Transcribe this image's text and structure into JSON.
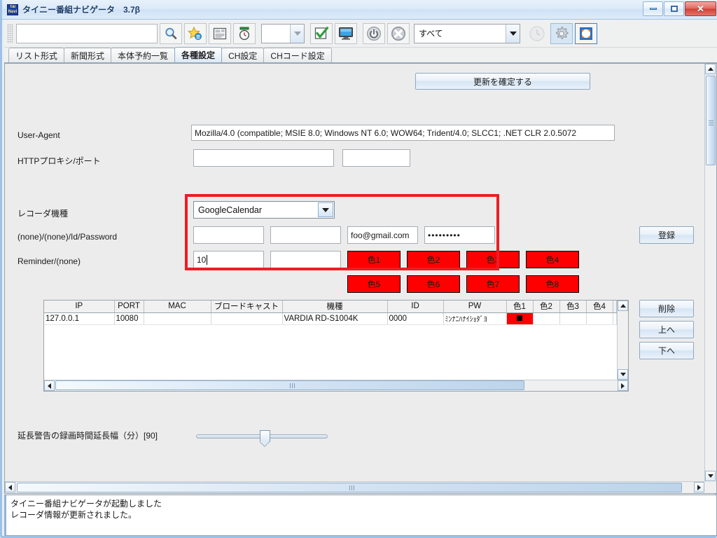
{
  "window": {
    "title": "タイニー番組ナビゲータ　3.7β",
    "icon": "app-icon",
    "minimize_label": "最小化",
    "maximize_label": "最大化",
    "close_label": "閉じる"
  },
  "toolbar": {
    "search_value": "",
    "search_placeholder": "",
    "buttons": [
      {
        "name": "search-icon",
        "label": "検索"
      },
      {
        "name": "favorite-star-icon",
        "label": "お気に入り"
      },
      {
        "name": "newspaper-icon",
        "label": "新聞形式"
      },
      {
        "name": "timer-icon",
        "label": "タイマー"
      }
    ],
    "small_combo_value": "",
    "buttons2": [
      {
        "name": "check-icon",
        "label": "確定"
      },
      {
        "name": "monitor-icon",
        "label": "モニタ"
      },
      {
        "name": "power-icon",
        "label": "電源"
      },
      {
        "name": "cancel-icon",
        "label": "キャンセル"
      }
    ],
    "filter_combo_value": "すべて",
    "buttons3": [
      {
        "name": "clock-icon",
        "label": "時計"
      },
      {
        "name": "gear-icon",
        "label": "設定"
      },
      {
        "name": "fullscreen-icon",
        "label": "全画面"
      }
    ]
  },
  "tabs": [
    {
      "label": "リスト形式",
      "active": false
    },
    {
      "label": "新聞形式",
      "active": false
    },
    {
      "label": "本体予約一覧",
      "active": false
    },
    {
      "label": "各種設定",
      "active": true
    },
    {
      "label": "CH設定",
      "active": false
    },
    {
      "label": "CHコード設定",
      "active": false
    }
  ],
  "settings": {
    "commit_button": "更新を確定する",
    "user_agent_label": "User-Agent",
    "user_agent_value": "Mozilla/4.0 (compatible; MSIE 8.0; Windows NT 6.0; WOW64; Trident/4.0; SLCC1; .NET CLR 2.0.5072",
    "proxy_label": "HTTPプロキシ/ポート",
    "proxy_host_value": "",
    "proxy_port_value": "",
    "recorder_model_label": "レコーダ機種",
    "recorder_model_value": "GoogleCalendar",
    "credentials_label": "(none)/(none)/Id/Password",
    "cred_field1": "",
    "cred_field2": "",
    "cred_id": "foo@gmail.com",
    "cred_password": "•••••••••",
    "reminder_label": "Reminder/(none)",
    "reminder_value": "10",
    "reminder_field2": "",
    "register_button": "登録",
    "delete_button": "削除",
    "up_button": "上へ",
    "down_button": "下へ",
    "color_buttons": [
      {
        "label": "色1",
        "color": "#ff0000"
      },
      {
        "label": "色2",
        "color": "#ff0000"
      },
      {
        "label": "色3",
        "color": "#ff0000"
      },
      {
        "label": "色4",
        "color": "#ff0000"
      },
      {
        "label": "色5",
        "color": "#ff0000"
      },
      {
        "label": "色6",
        "color": "#ff0000"
      },
      {
        "label": "色7",
        "color": "#ff0000"
      },
      {
        "label": "色8",
        "color": "#ff0000"
      }
    ],
    "highlight_border_color": "#ee1c24",
    "slider_label": "延長警告の録画時間延長幅（分）[90]",
    "slider_value": 90,
    "slider_min": 0,
    "slider_max": 240
  },
  "recorder_table": {
    "columns": [
      "IP",
      "PORT",
      "MAC",
      "ブロードキャスト",
      "機種",
      "ID",
      "PW",
      "色1",
      "色2",
      "色3",
      "色4"
    ],
    "rows": [
      {
        "IP": "127.0.0.1",
        "PORT": "10080",
        "MAC": "",
        "ブロードキャスト": "",
        "機種": "VARDIA RD-S1004K",
        "ID": "0000",
        "PW": "ﾐﾝﾅﾆﾊﾅｲｼｮﾀﾞﾖ",
        "色1": "",
        "色2": "",
        "色3": "",
        "色4": ""
      }
    ],
    "row_swatch_color": "#ff0000"
  },
  "statusbar": {
    "lines": [
      "タイニー番組ナビゲータが起動しました",
      "レコーダ情報が更新されました。"
    ]
  }
}
